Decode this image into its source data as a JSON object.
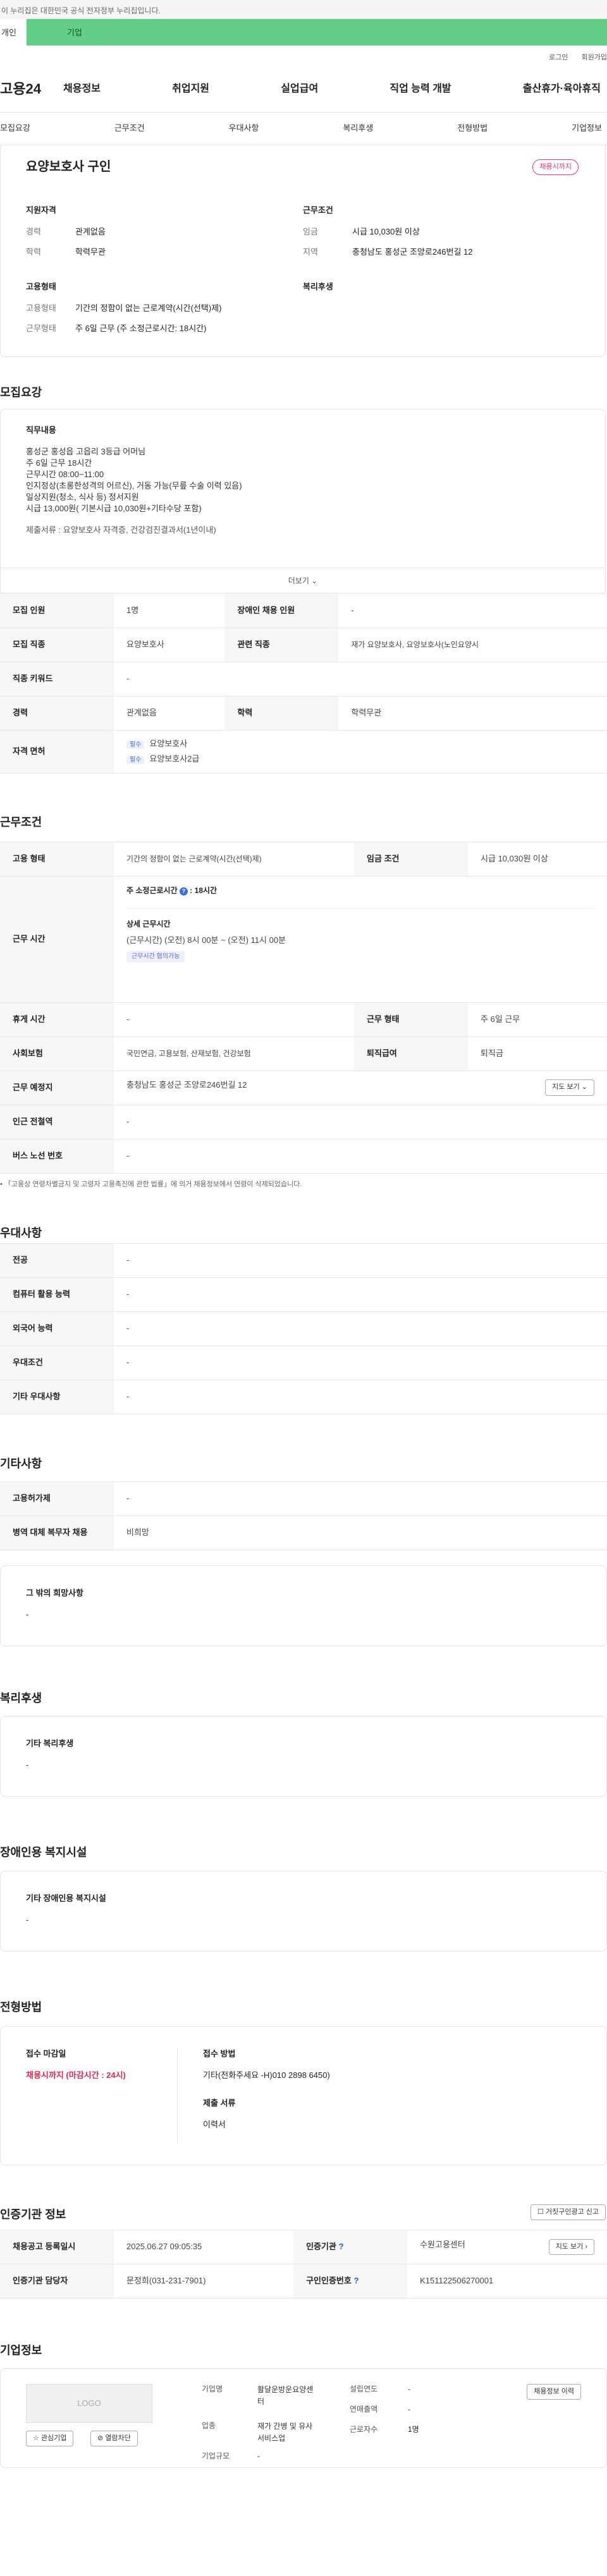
{
  "gov_banner": "이 누리집은 대한민국 공식 전자정부 누리집입니다.",
  "member_tabs": {
    "individual": "개인",
    "enterprise": "기업"
  },
  "util": {
    "login": "로그인",
    "join": "회원가입"
  },
  "gnb": {
    "logo": "고용24",
    "menu": [
      "채용정보",
      "취업지원",
      "실업급여",
      "직업 능력 개발",
      "출산휴가·육아휴직"
    ]
  },
  "anchors": [
    "모집요강",
    "근무조건",
    "우대사항",
    "복리후생",
    "전형방법",
    "기업정보"
  ],
  "job": {
    "title": "요양보호사 구인",
    "status_badge": "채용시까지",
    "qual": {
      "heading": "지원자격",
      "rows": [
        {
          "k": "경력",
          "v": "관계없음"
        },
        {
          "k": "학력",
          "v": "학력무관"
        }
      ]
    },
    "cond": {
      "heading": "근무조건",
      "rows": [
        {
          "k": "임금",
          "v": "시급 10,030원 이상"
        },
        {
          "k": "지역",
          "v": "충청남도 홍성군 조양로246번길 12"
        }
      ]
    },
    "emp": {
      "heading": "고용형태",
      "rows": [
        {
          "k": "고용형태",
          "v": "기간의 정함이 없는 근로계약(시간(선택)제)"
        },
        {
          "k": "근무형태",
          "v": "주 6일 근무 (주 소정근로시간: 18시간)"
        }
      ]
    },
    "welfare_heading": "복리후생"
  },
  "recruit": {
    "section": "모집요강",
    "duty_heading": "직무내용",
    "duty_lines": [
      "홍성군 홍성읍 고읍리 3등급 어머님",
      "주 6일 근무 18시간",
      "근무시간 08:00~11:00",
      "인지정상(초롱한성격의 어르신), 거동 가능(무릎 수술 이력 있음)",
      "일상지원(청소, 식사 등) 정서지원",
      "시급 13,000원( 기본시급 10,030원+기타수당 포함)"
    ],
    "docs": "제출서류 : 요양보호사 자격증, 건강검진결과서(1년이내)",
    "more": "더보기",
    "table": {
      "headcount_label": "모집 인원",
      "headcount": "1명",
      "disabled_label": "장애인 채용 인원",
      "disabled": "-",
      "job_label": "모집 직종",
      "job": "요양보호사",
      "related_label": "관련 직종",
      "related": "재가 요양보호사, 요양보호사(노인요양시",
      "keyword_label": "직종 키워드",
      "keyword": "-",
      "career_label": "경력",
      "career": "관계없음",
      "edu_label": "학력",
      "edu": "학력무관",
      "license_label": "자격 면허",
      "license_req": "필수",
      "licenses": [
        "요양보호사",
        "요양보호사2급"
      ]
    }
  },
  "work": {
    "section": "근무조건",
    "type_label": "고용 형태",
    "type": "기간의 정함이 없는 근로계약(시간(선택)제)",
    "wage_label": "임금 조건",
    "wage": "시급 10,030원 이상",
    "hours_label": "근무 시간",
    "weekly_label": "주 소정근로시간",
    "weekly": "18시간",
    "detail_label": "상세 근무시간",
    "detail": "(근무시간) (오전) 8시 00분 ~ (오전) 11시 00분",
    "consult": "근무시간 협의가능",
    "rest_label": "휴게 시간",
    "rest": "-",
    "form_label": "근무 형태",
    "form": "주 6일 근무",
    "ins_label": "사회보험",
    "ins": "국민연금, 고용보험, 산재보험, 건강보험",
    "ret_label": "퇴직급여",
    "ret": "퇴직금",
    "place_label": "근무 예정지",
    "place": "충청남도 홍성군 조양로246번길 12",
    "map_btn": "지도 보기",
    "station_label": "인근 전철역",
    "station": "-",
    "bus_label": "버스 노선 번호",
    "bus": "-",
    "note": "「고용상 연령차별금지 및 고령자 고용촉진에 관한 법률」에 의거 채용정보에서 연령이 삭제되었습니다."
  },
  "pref": {
    "section": "우대사항",
    "rows": [
      {
        "k": "전공",
        "v": "-"
      },
      {
        "k": "컴퓨터 활용 능력",
        "v": "-"
      },
      {
        "k": "외국어 능력",
        "v": "-"
      },
      {
        "k": "우대조건",
        "v": "-"
      },
      {
        "k": "기타 우대사항",
        "v": "-"
      }
    ]
  },
  "etc": {
    "section": "기타사항",
    "rows": [
      {
        "k": "고용허가제",
        "v": "-"
      },
      {
        "k": "병역 대체 복무자 채용",
        "v": "비희망"
      }
    ],
    "hope_heading": "그 밖의 희망사항",
    "hope": "-"
  },
  "welfare": {
    "section": "복리후생",
    "heading": "기타 복리후생",
    "value": "-"
  },
  "disab": {
    "section": "장애인용 복지시설",
    "heading": "기타 장애인용 복지시설",
    "value": "-"
  },
  "select": {
    "section": "전형방법",
    "deadline_label": "접수 마감일",
    "deadline": "채용시까지 (마감시간 : 24시)",
    "method_label": "접수 방법",
    "method": "기타(전화주세요 -H)010 2898 6450)",
    "docs_label": "제출 서류",
    "docs": "이력서"
  },
  "agency": {
    "section": "인증기관 정보",
    "report_btn": "거짓구인광고 신고",
    "reg_label": "채용공고 등록일시",
    "reg": "2025.06.27 09:05:35",
    "org_label": "인증기관",
    "org": "수원고용센터",
    "map_btn": "지도 보기",
    "manager_label": "인증기관 담당자",
    "manager": "문정희(031-231-7901)",
    "num_label": "구인인증번호",
    "num": "K151122506270001"
  },
  "company": {
    "section": "기업정보",
    "logo": "LOGO",
    "interest_btn": "관심기업",
    "block_btn": "열람차단",
    "name_label": "기업명",
    "name_lines": [
      "활달운방운요양센",
      "터"
    ],
    "est_label": "설립연도",
    "est": "-",
    "sales_label": "연매출액",
    "sales": "-",
    "ind_label": "업종",
    "ind_lines": [
      "재가 간병 및 유사",
      "서비스업"
    ],
    "workers_label": "근로자수",
    "workers": "1명",
    "size_label": "기업규모",
    "size": "-",
    "jobs_btn": "채용정보 이력"
  }
}
